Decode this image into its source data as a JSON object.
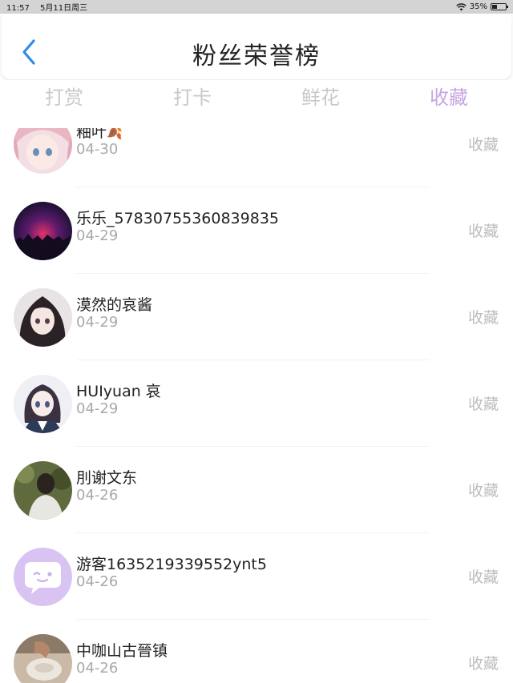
{
  "status_bar": {
    "time": "11:57",
    "date": "5月11日周三",
    "battery_percent": "35%",
    "battery_level": 0.35
  },
  "header": {
    "title": "粉丝荣誉榜",
    "back_icon": "chevron-left-icon"
  },
  "tabs": [
    {
      "label": "打赏",
      "active": false
    },
    {
      "label": "打卡",
      "active": false
    },
    {
      "label": "鲜花",
      "active": false
    },
    {
      "label": "收藏",
      "active": true
    }
  ],
  "fans": [
    {
      "name": "釉叶",
      "date": "04-30",
      "action": "收藏",
      "avatar": "anime-girl-pink-avatar"
    },
    {
      "name": "乐乐_57830755360839835",
      "date": "04-29",
      "action": "收藏",
      "avatar": "night-sky-avatar"
    },
    {
      "name": "漠然的哀酱",
      "date": "04-29",
      "action": "收藏",
      "avatar": "anime-girl-dark-hair-avatar"
    },
    {
      "name": "HUIyuan 哀",
      "date": "04-29",
      "action": "收藏",
      "avatar": "anime-girl-uniform-avatar"
    },
    {
      "name": "刖谢文东",
      "date": "04-26",
      "action": "收藏",
      "avatar": "photo-person-avatar"
    },
    {
      "name": "游客1635219339552ynt5",
      "date": "04-26",
      "action": "收藏",
      "avatar": "guest-chat-avatar"
    },
    {
      "name": "中咖山古晉镇",
      "date": "04-26",
      "action": "收藏",
      "avatar": "photo-hand-avatar"
    }
  ],
  "colors": {
    "accent_tab": "#c8a5e3",
    "inactive_tab": "#c9c9c9",
    "back_arrow": "#2f8de4",
    "guest_avatar_bg": "#d9c3f2"
  }
}
